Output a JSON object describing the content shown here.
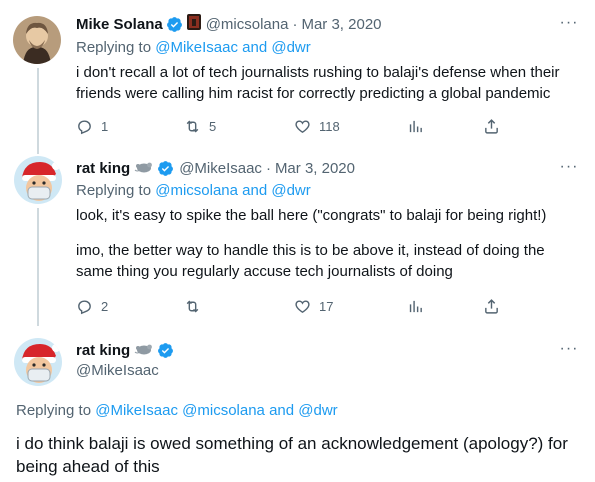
{
  "tweets": [
    {
      "name": "Mike Solana",
      "handle": "@micsolana",
      "date": "Mar 3, 2020",
      "replying_label": "Replying to",
      "replying_to": [
        "@MikeIsaac",
        "@dwr"
      ],
      "joiner": "and",
      "text": "i don't recall a lot of tech journalists rushing to balaji's defense when their friends were calling him racist for correctly predicting a global pandemic",
      "replies": "1",
      "retweets": "5",
      "likes": "118",
      "more": "···"
    },
    {
      "name": "rat king",
      "handle": "@MikeIsaac",
      "date": "Mar 3, 2020",
      "replying_label": "Replying to",
      "replying_to": [
        "@micsolana",
        "@dwr"
      ],
      "joiner": "and",
      "text_1": "look, it's easy to spike the ball here (\"congrats\" to balaji for being right!)",
      "text_2": "imo, the better way to handle this is to be above it, instead of doing the same thing you regularly accuse tech journalists of doing",
      "replies": "2",
      "retweets": "",
      "likes": "17",
      "more": "···"
    }
  ],
  "focused": {
    "name": "rat king",
    "handle": "@MikeIsaac",
    "replying_label": "Replying to",
    "replying_to": [
      "@MikeIsaac",
      "@micsolana"
    ],
    "joiner": "and",
    "replying_last": "@dwr",
    "text": "i do think balaji is owed something of an acknowledgement (apology?) for being ahead of this",
    "more": "···"
  },
  "colors": {
    "link": "#1d9bf0",
    "secondary": "#536471",
    "verified": "#1d9bf0"
  },
  "icons": [
    "reply-icon",
    "retweet-icon",
    "like-icon",
    "views-icon",
    "share-icon",
    "verified-badge-icon",
    "rat-emoji-icon"
  ]
}
